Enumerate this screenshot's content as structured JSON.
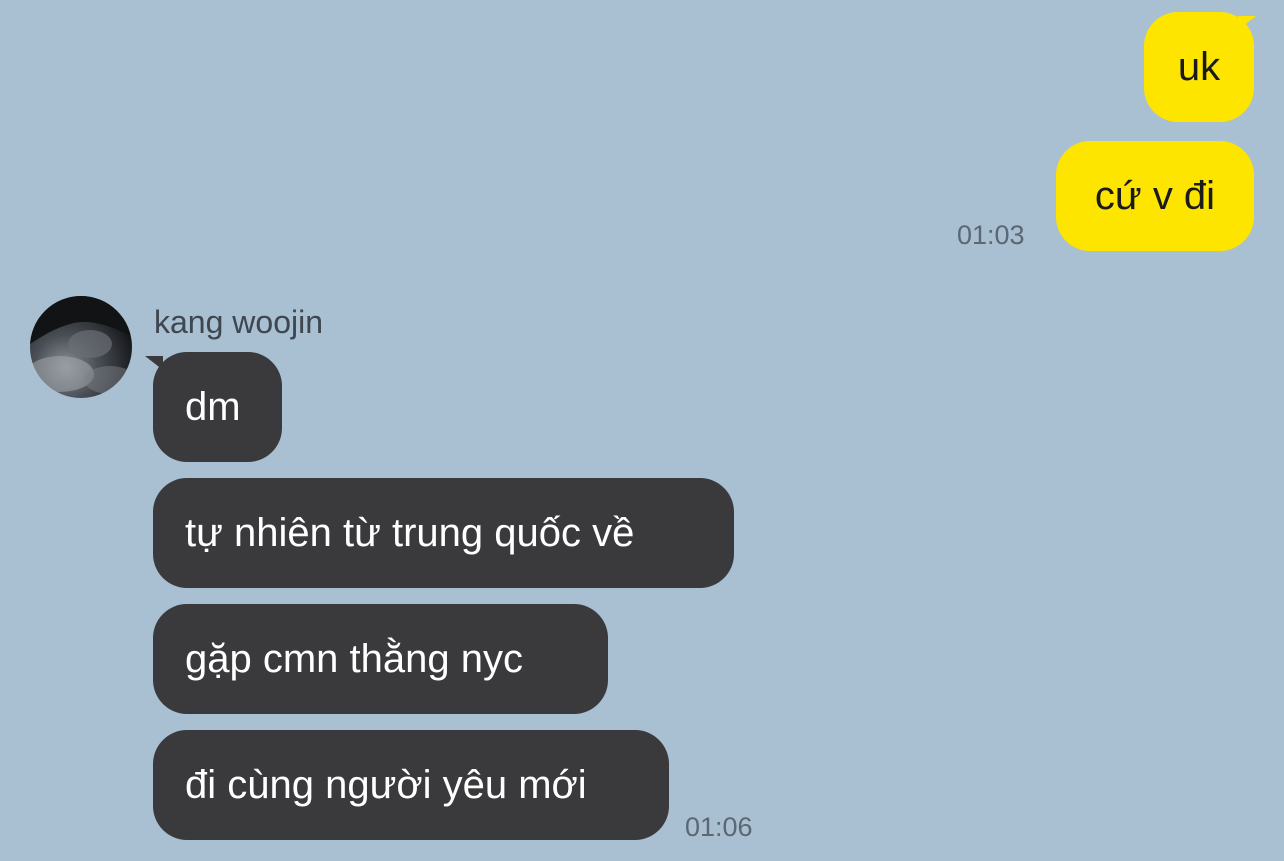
{
  "sent": {
    "messages": [
      {
        "text": "uk"
      },
      {
        "text": "cứ v đi"
      }
    ],
    "time": "01:03"
  },
  "received": {
    "sender_name": "kang woojin",
    "messages": [
      {
        "text": "dm"
      },
      {
        "text": "tự nhiên từ trung quốc về"
      },
      {
        "text": "gặp cmn thằng nyc"
      },
      {
        "text": "đi cùng người yêu mới"
      }
    ],
    "time": "01:06"
  },
  "colors": {
    "background": "#a9bfd2",
    "sent_bubble": "#fee500",
    "received_bubble": "#3a3a3c"
  },
  "icons": {
    "avatar": "profile-photo"
  }
}
